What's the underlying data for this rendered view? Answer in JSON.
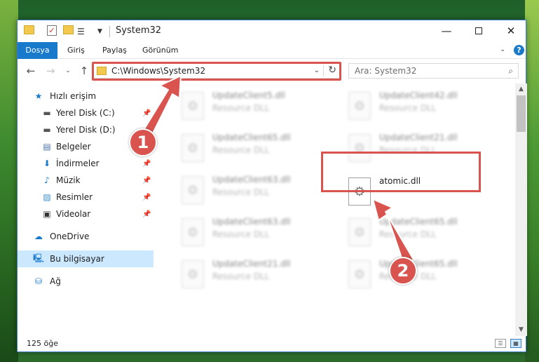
{
  "window": {
    "title": "System32",
    "minimize": "—",
    "close": "✕"
  },
  "ribbon": {
    "tabs": [
      "Dosya",
      "Giriş",
      "Paylaş",
      "Görünüm"
    ]
  },
  "navigation": {
    "address": "C:\\Windows\\System32",
    "search_placeholder": "Ara: System32"
  },
  "sidebar": {
    "items": [
      {
        "label": "Hızlı erişim",
        "icon": "star-icon",
        "pinned": false
      },
      {
        "label": "Yerel Disk (C:)",
        "icon": "drive-icon",
        "pinned": true
      },
      {
        "label": "Yerel Disk (D:)",
        "icon": "drive-icon",
        "pinned": false
      },
      {
        "label": "Belgeler",
        "icon": "documents-icon",
        "pinned": false
      },
      {
        "label": "İndirmeler",
        "icon": "download-icon",
        "pinned": true
      },
      {
        "label": "Müzik",
        "icon": "music-icon",
        "pinned": true
      },
      {
        "label": "Resimler",
        "icon": "pictures-icon",
        "pinned": true
      },
      {
        "label": "Videolar",
        "icon": "videos-icon",
        "pinned": true
      },
      {
        "label": "OneDrive",
        "icon": "cloud-icon",
        "pinned": false
      },
      {
        "label": "Bu bilgisayar",
        "icon": "computer-icon",
        "pinned": false,
        "selected": true
      },
      {
        "label": "Ağ",
        "icon": "network-icon",
        "pinned": false
      }
    ]
  },
  "files": [
    {
      "name": "UpdateClient5.dll",
      "type": "Resource DLL",
      "blurred": true
    },
    {
      "name": "UpdateClient42.dll",
      "type": "Resource DLL",
      "blurred": true
    },
    {
      "name": "UpdateClient65.dll",
      "type": "Resource DLL",
      "blurred": true
    },
    {
      "name": "UpdateClient21.dll",
      "type": "Resource DLL",
      "blurred": true
    },
    {
      "name": "UpdateClient63.dll",
      "type": "Resource DLL",
      "blurred": true
    },
    {
      "name": "atomic.dll",
      "type": "",
      "blurred": false
    },
    {
      "name": "UpdateClient63.dll",
      "type": "Resource DLL",
      "blurred": true
    },
    {
      "name": "UpdateClient65.dll",
      "type": "Resource DLL",
      "blurred": true
    },
    {
      "name": "UpdateClient21.dll",
      "type": "Resource DLL",
      "blurred": true
    },
    {
      "name": "UpdateClient65.dll",
      "type": "Resource DLL",
      "blurred": true
    }
  ],
  "status": {
    "item_count": "125 öğe"
  },
  "annotations": {
    "badge_1": "1",
    "badge_2": "2",
    "color": "#d9534f"
  },
  "colors": {
    "accent": "#1979ca",
    "selection": "#cce8ff",
    "annotation": "#d9534f"
  }
}
